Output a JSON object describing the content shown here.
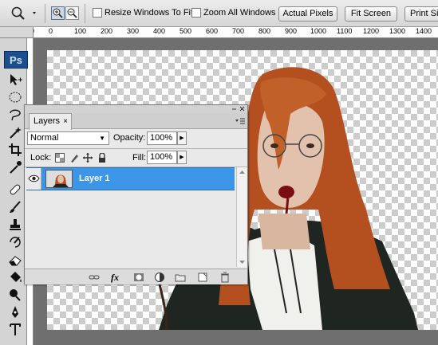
{
  "options_bar": {
    "resize_windows_label": "Resize Windows To Fit",
    "zoom_all_windows_label": "Zoom All Windows",
    "actual_pixels_label": "Actual Pixels",
    "fit_screen_label": "Fit Screen",
    "print_size_label": "Print Si"
  },
  "ruler": {
    "marks": [
      "100",
      "0",
      "100",
      "200",
      "300",
      "400",
      "500",
      "600",
      "700",
      "800",
      "900",
      "1000",
      "1100",
      "1200",
      "1300",
      "1400"
    ]
  },
  "toolbox": {
    "logo": "Ps"
  },
  "layers_panel": {
    "tab_label": "Layers",
    "tab_close": "×",
    "blend_mode": "Normal",
    "opacity_label": "Opacity:",
    "opacity_value": "100%",
    "lock_label": "Lock:",
    "fill_label": "Fill:",
    "fill_value": "100%",
    "layers": [
      {
        "name": "Layer 1",
        "visible": true,
        "selected": true
      }
    ],
    "fx_label": "fx"
  },
  "colors": {
    "selection": "#3d95e8",
    "hair": "#b4501f",
    "jacket": "#1f2520"
  }
}
